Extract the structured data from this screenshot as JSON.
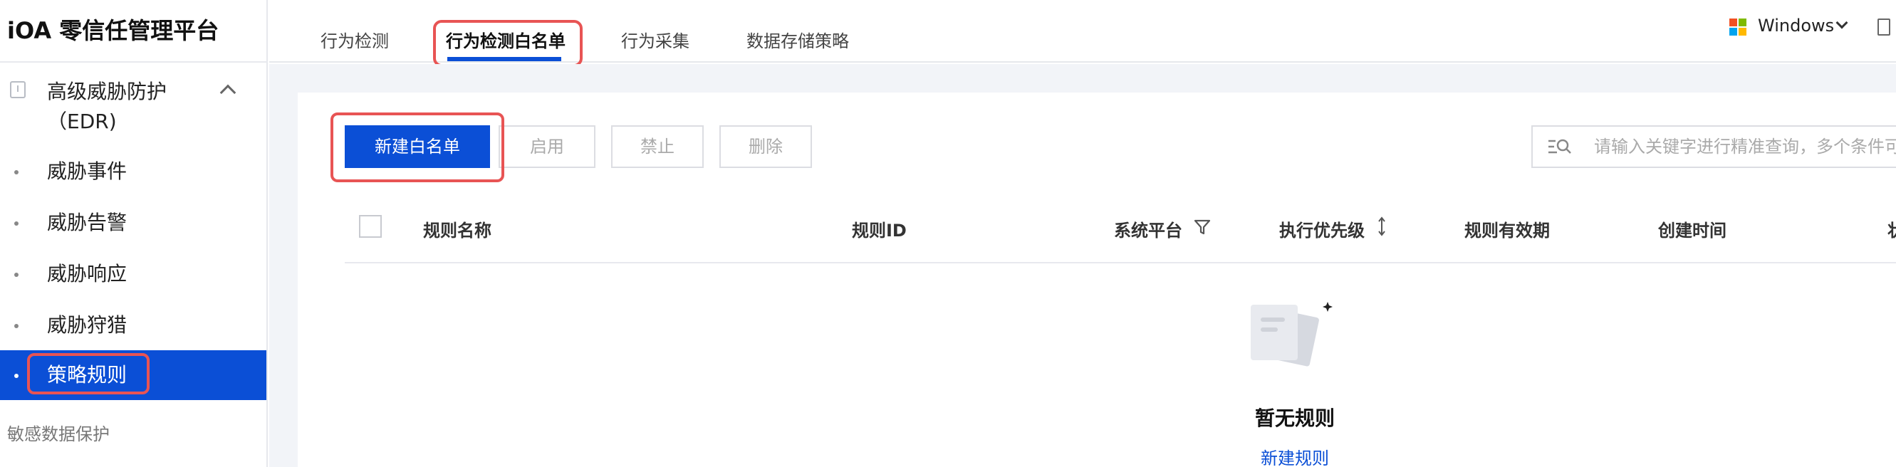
{
  "app": {
    "title": "iOA 零信任管理平台"
  },
  "sidebar": {
    "group": {
      "label": "高级威胁防护（EDR)",
      "icon": "alert-square-icon"
    },
    "items": [
      {
        "label": "威胁事件"
      },
      {
        "label": "威胁告警"
      },
      {
        "label": "威胁响应"
      },
      {
        "label": "威胁狩猎"
      },
      {
        "label": "策略规则",
        "active": true
      }
    ],
    "next_group": "敏感数据保护"
  },
  "tabs": [
    {
      "label": "行为检测"
    },
    {
      "label": "行为检测白名单",
      "active": true
    },
    {
      "label": "行为采集"
    },
    {
      "label": "数据存储策略"
    }
  ],
  "platform_select": {
    "value": "Windows",
    "icon": "windows-logo-icon"
  },
  "toolbar": {
    "new_label": "新建白名单",
    "enable_label": "启用",
    "disable_label": "禁止",
    "delete_label": "删除"
  },
  "search": {
    "placeholder": "请输入关键字进行精准查询，多个条件可"
  },
  "table": {
    "columns": [
      "规则名称",
      "规则ID",
      "系统平台",
      "执行优先级",
      "规则有效期",
      "创建时间",
      "状"
    ]
  },
  "empty_state": {
    "title": "暂无规则",
    "link": "新建规则"
  },
  "colors": {
    "accent": "#0b4fd6",
    "annotation": "#e85454",
    "content_bg": "#f2f4f8"
  }
}
